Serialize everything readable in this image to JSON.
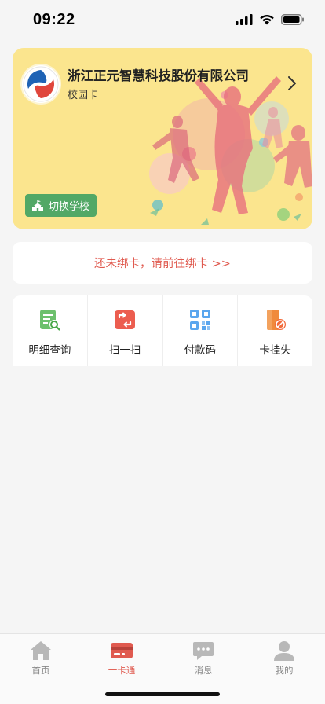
{
  "status_bar": {
    "time": "09:22"
  },
  "campus_card": {
    "school_name": "浙江正元智慧科技股份有限公司",
    "card_type": "校园卡",
    "switch_school_label": "切换学校"
  },
  "bind_banner": {
    "text": "还未绑卡，请前往绑卡 >>"
  },
  "quick_actions": [
    {
      "label": "明细查询",
      "icon": "detail-query-icon",
      "color": "#5cb85c"
    },
    {
      "label": "扫一扫",
      "icon": "scan-icon",
      "color": "#e8584a"
    },
    {
      "label": "付款码",
      "icon": "qr-code-icon",
      "color": "#4a9be8"
    },
    {
      "label": "卡挂失",
      "icon": "card-loss-icon",
      "color": "#f08a3c"
    }
  ],
  "tab_bar": {
    "items": [
      {
        "label": "首页",
        "icon": "home-icon",
        "active": false
      },
      {
        "label": "一卡通",
        "icon": "card-icon",
        "active": true
      },
      {
        "label": "消息",
        "icon": "message-icon",
        "active": false
      },
      {
        "label": "我的",
        "icon": "profile-icon",
        "active": false
      }
    ],
    "active_color": "#e05a4f",
    "inactive_color": "#b8b8b8"
  }
}
